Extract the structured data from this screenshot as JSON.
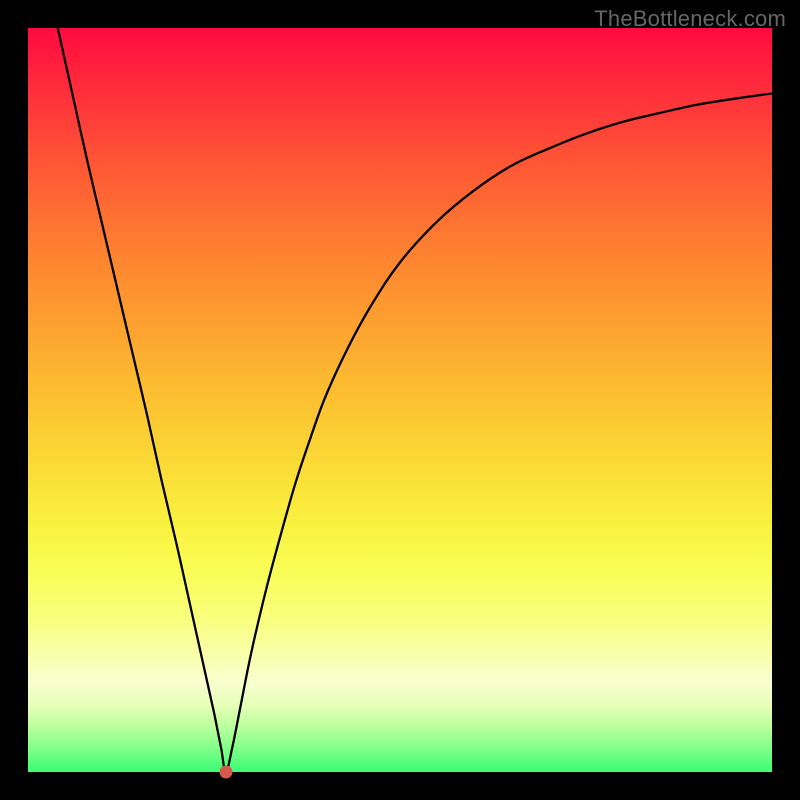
{
  "watermark": "TheBottleneck.com",
  "colors": {
    "frame": "#000000",
    "dot": "#d35a4a",
    "curve": "#000000",
    "watermark": "#666666"
  },
  "chart_data": {
    "type": "line",
    "title": "",
    "xlabel": "",
    "ylabel": "",
    "xlim": [
      0,
      100
    ],
    "ylim": [
      0,
      100
    ],
    "grid": false,
    "legend": false,
    "marker": {
      "x": 26.6,
      "y": 0,
      "color": "#d35a4a"
    },
    "x": [
      4,
      6,
      8,
      10,
      12,
      14,
      16,
      18,
      20,
      22,
      23,
      24,
      25,
      25.5,
      26,
      26.6,
      27.5,
      28.5,
      30,
      32,
      34,
      36,
      38,
      40,
      43,
      46,
      50,
      55,
      60,
      65,
      70,
      75,
      80,
      85,
      90,
      95,
      100
    ],
    "y": [
      100,
      91,
      82,
      73.5,
      65,
      56.5,
      48,
      39,
      30.5,
      21.5,
      17,
      12.5,
      8,
      5.5,
      3,
      0,
      3.5,
      8.5,
      16,
      24.5,
      32,
      39,
      45,
      50.5,
      57,
      62.5,
      68.5,
      74,
      78.2,
      81.5,
      83.8,
      85.8,
      87.4,
      88.6,
      89.7,
      90.5,
      91.2
    ]
  }
}
